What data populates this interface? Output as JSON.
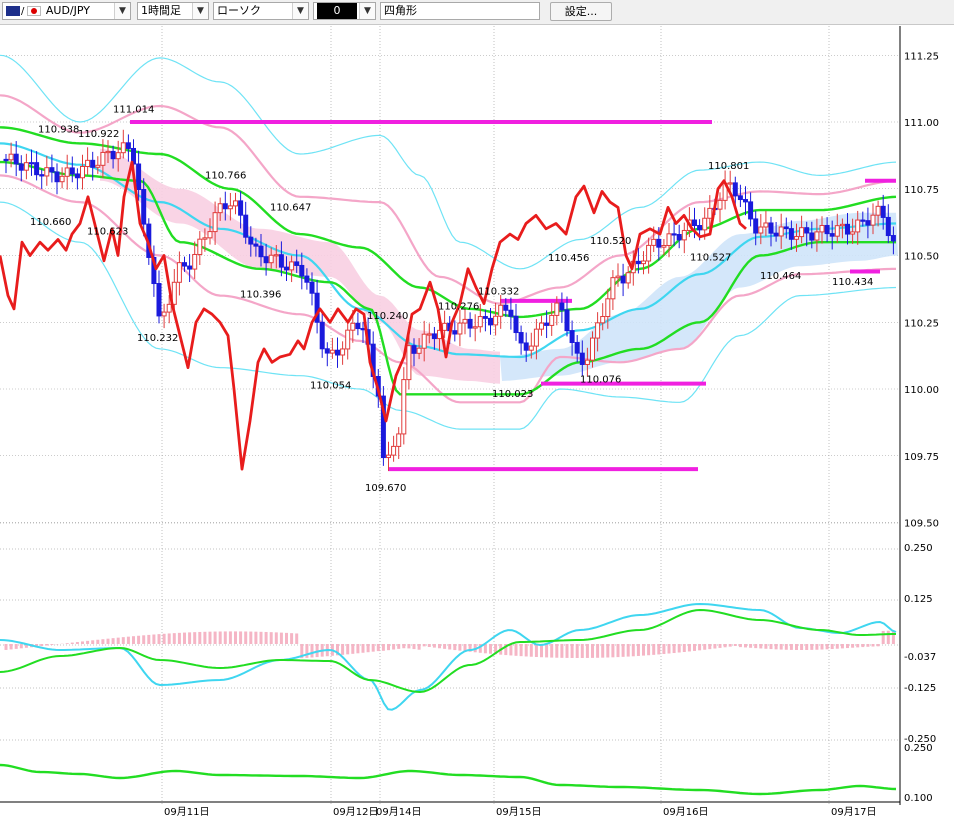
{
  "toolbar": {
    "pair": "AUD/JPY",
    "timeframe": "1時間足",
    "chart_style": "ローソク",
    "color_value": "0",
    "drawing_tool": "四角形",
    "settings_label": "設定..."
  },
  "colors": {
    "bull_candle": "#e03c3c",
    "bear_candle": "#1a1adc",
    "cloud_bull": "#cfe4fa",
    "cloud_bear": "#f8cfe2",
    "bollinger_inner": "#f4a6c8",
    "bollinger_outer": "#6fe3f5",
    "mid_line": "#3fd6f0",
    "ma_green": "#22dd22",
    "lagging_red": "#e81c1c",
    "level_magenta": "#f020e0",
    "macd_hist": "#f5b5c5"
  },
  "chart_data": [
    {
      "type": "candlestick",
      "y_ticks": [
        "111.25",
        "111.00",
        "110.75",
        "110.50",
        "110.25",
        "110.00",
        "109.75",
        "109.50"
      ],
      "ylim": [
        109.5,
        111.3
      ],
      "x_labels": [
        "09月11日",
        "09月12日",
        "09月14日",
        "09月15日",
        "09月16日",
        "09月17日"
      ],
      "annotations": [
        {
          "text": "111.014",
          "value": 111.014
        },
        {
          "text": "110.938",
          "value": 110.938
        },
        {
          "text": "110.922",
          "value": 110.922
        },
        {
          "text": "110.766",
          "value": 110.766
        },
        {
          "text": "110.660",
          "value": 110.66
        },
        {
          "text": "110.623",
          "value": 110.623
        },
        {
          "text": "110.647",
          "value": 110.647
        },
        {
          "text": "110.396",
          "value": 110.396
        },
        {
          "text": "110.232",
          "value": 110.232
        },
        {
          "text": "110.054",
          "value": 110.054
        },
        {
          "text": "110.240",
          "value": 110.24
        },
        {
          "text": "110.276",
          "value": 110.276
        },
        {
          "text": "110.332",
          "value": 110.332
        },
        {
          "text": "109.670",
          "value": 109.67
        },
        {
          "text": "110.023",
          "value": 110.023
        },
        {
          "text": "110.456",
          "value": 110.456
        },
        {
          "text": "110.520",
          "value": 110.52
        },
        {
          "text": "110.076",
          "value": 110.076
        },
        {
          "text": "110.801",
          "value": 110.801
        },
        {
          "text": "110.527",
          "value": 110.527
        },
        {
          "text": "110.464",
          "value": 110.464
        },
        {
          "text": "110.434",
          "value": 110.434
        }
      ],
      "levels": [
        111.0,
        110.33,
        110.02,
        109.7,
        110.78,
        110.44
      ]
    },
    {
      "type": "line",
      "panel": "macd",
      "y_ticks": [
        "0.250",
        "0.125",
        "-0.037",
        "-0.125",
        "-0.250"
      ]
    },
    {
      "type": "line",
      "panel": "oscillator",
      "y_ticks": [
        "0.250",
        "0.100"
      ]
    }
  ]
}
